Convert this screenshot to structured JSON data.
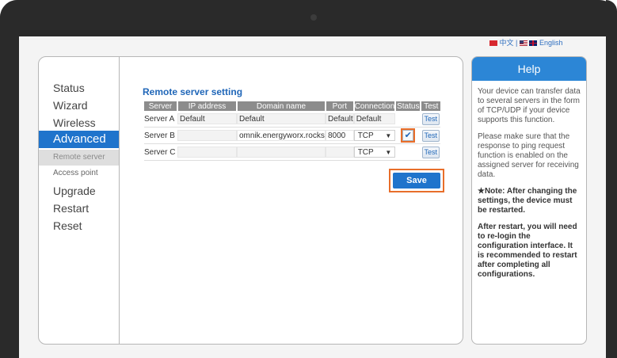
{
  "language": {
    "chinese": "中文",
    "separator": "|",
    "english": "English"
  },
  "nav": {
    "items": [
      "Status",
      "Wizard",
      "Wireless"
    ],
    "active": "Advanced",
    "sub_items": [
      "Remote server",
      "Access point"
    ],
    "more_items": [
      "Upgrade",
      "Restart",
      "Reset"
    ]
  },
  "section_title": "Remote server setting",
  "table": {
    "headers": [
      "Server",
      "IP address",
      "Domain name",
      "Port",
      "Connection",
      "Status",
      "Test"
    ],
    "rows": [
      {
        "server": "Server A",
        "ip": "Default",
        "domain": "Default",
        "port": "Default",
        "connection": "Default",
        "status": "",
        "test": "Test"
      },
      {
        "server": "Server B",
        "ip": "",
        "domain": "omnik.energyworx.rocks",
        "port": "8000",
        "connection": "TCP",
        "status": "checked",
        "test": "Test"
      },
      {
        "server": "Server C",
        "ip": "",
        "domain": "",
        "port": "",
        "connection": "TCP",
        "status": "",
        "test": "Test"
      }
    ]
  },
  "save_label": "Save",
  "help": {
    "title": "Help",
    "p1": "Your device can transfer data to several servers in the form of TCP/UDP if your device supports this function.",
    "p2": "Please make sure that the response to ping request function is enabled on the assigned server for receiving data.",
    "p3": "★Note: After changing the settings, the device must be restarted.",
    "p4": "After restart, you will need to re-login the configuration interface. It is recommended to restart after completing all configurations."
  },
  "colors": {
    "accent": "#1f74cc",
    "highlight": "#e86e2a",
    "header_gray": "#8c8c8c"
  },
  "icons": {
    "status_check": "checkmark-icon",
    "select_arrow": "dropdown-arrow-icon"
  }
}
